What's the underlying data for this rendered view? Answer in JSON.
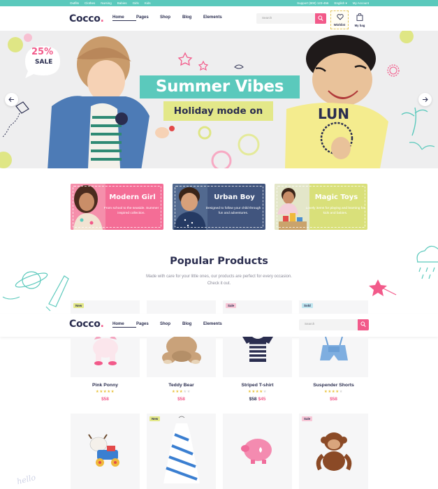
{
  "topbar": {
    "links": [
      "Outfits",
      "Clothes",
      "Nursing",
      "Babies",
      "Girls",
      "Kids"
    ],
    "support": "Support (800) 123-456",
    "language": "English",
    "account": "My Account"
  },
  "header": {
    "logo": "Cocco",
    "logo_dot": ".",
    "nav": [
      "Home",
      "Pages",
      "Shop",
      "Blog",
      "Elements"
    ],
    "search_placeholder": "Search",
    "wishlist": "Wishlist",
    "bag": "My bag"
  },
  "hero": {
    "sale_percent": "25%",
    "sale_word": "SALE",
    "title": "Summer Vibes",
    "subtitle": "Holiday mode on"
  },
  "categories": [
    {
      "title": "Modern Girl",
      "desc": "From school to the seaside. Summer inspired collection.",
      "color": "#f46d96"
    },
    {
      "title": "Urban Boy",
      "desc": "Designed to follow your child through fun and adventures.",
      "color": "#41557e"
    },
    {
      "title": "Magic Toys",
      "desc": "Lovely items for playing and learning for kids and babies.",
      "color": "#d9e07a"
    }
  ],
  "popular": {
    "title": "Popular Products",
    "description": "Made with care for your little ones, our products are perfect for every occasion. Check it out."
  },
  "top_badges": [
    "New",
    "Sale",
    "Sold"
  ],
  "products": [
    {
      "name": "Pink Ponny",
      "rating": 5,
      "price": "$58"
    },
    {
      "name": "Teddy Bear",
      "rating": 3,
      "price": "$58"
    },
    {
      "name": "Striped T-shirt",
      "rating": 4,
      "old_price": "$58",
      "price": "$45"
    },
    {
      "name": "Suspender Shorts",
      "rating": 4,
      "price": "$58"
    }
  ],
  "bottom_badges": [
    "New",
    "Sale"
  ],
  "decor_text": "hello",
  "colors": {
    "teal": "#5bc9bc",
    "pink": "#f25a8a",
    "navy": "#2a2d4f",
    "lime": "#e3e889",
    "star": "#e8c23c"
  }
}
